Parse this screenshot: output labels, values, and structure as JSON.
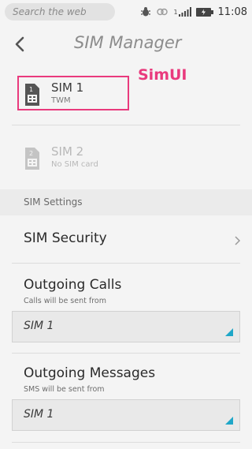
{
  "status_bar": {
    "search_placeholder": "Search the web",
    "signal_label": "1",
    "time": "11:08",
    "icons": [
      "bug-icon",
      "link-icon",
      "signal-icon",
      "battery-icon"
    ]
  },
  "header": {
    "title": "SIM Manager",
    "back_icon": "chevron-left-icon"
  },
  "annotation": {
    "label": "SimUI",
    "color": "#e93a7d"
  },
  "sims": [
    {
      "name": "SIM 1",
      "carrier": "TWM",
      "slot": "1",
      "active": true
    },
    {
      "name": "SIM 2",
      "carrier": "No SIM card",
      "slot": "2",
      "active": false
    }
  ],
  "settings": {
    "section_title": "SIM Settings",
    "sim_security": {
      "label": "SIM Security"
    },
    "outgoing_calls": {
      "label": "Outgoing Calls",
      "description": "Calls will be sent from",
      "selected": "SIM 1"
    },
    "outgoing_messages": {
      "label": "Outgoing Messages",
      "description": "SMS will be sent from",
      "selected": "SIM 1"
    }
  },
  "colors": {
    "accent": "#e93a7d",
    "select_triangle": "#1fa7c8",
    "background": "#f4f4f4"
  }
}
